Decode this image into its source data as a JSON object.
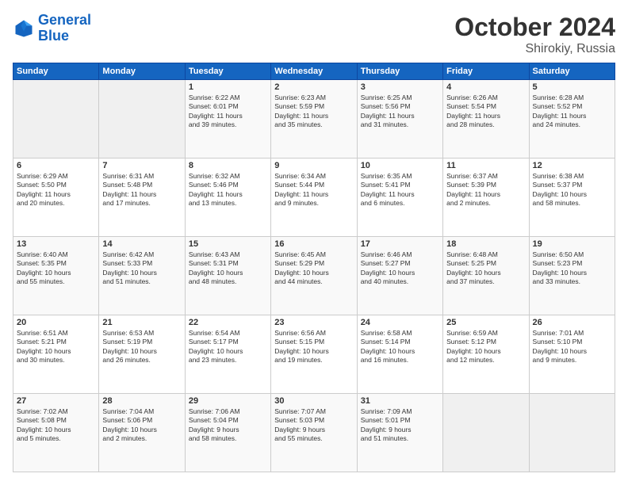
{
  "logo": {
    "line1": "General",
    "line2": "Blue"
  },
  "title": "October 2024",
  "subtitle": "Shirokiy, Russia",
  "days_of_week": [
    "Sunday",
    "Monday",
    "Tuesday",
    "Wednesday",
    "Thursday",
    "Friday",
    "Saturday"
  ],
  "weeks": [
    [
      {
        "day": "",
        "content": ""
      },
      {
        "day": "",
        "content": ""
      },
      {
        "day": "1",
        "content": "Sunrise: 6:22 AM\nSunset: 6:01 PM\nDaylight: 11 hours\nand 39 minutes."
      },
      {
        "day": "2",
        "content": "Sunrise: 6:23 AM\nSunset: 5:59 PM\nDaylight: 11 hours\nand 35 minutes."
      },
      {
        "day": "3",
        "content": "Sunrise: 6:25 AM\nSunset: 5:56 PM\nDaylight: 11 hours\nand 31 minutes."
      },
      {
        "day": "4",
        "content": "Sunrise: 6:26 AM\nSunset: 5:54 PM\nDaylight: 11 hours\nand 28 minutes."
      },
      {
        "day": "5",
        "content": "Sunrise: 6:28 AM\nSunset: 5:52 PM\nDaylight: 11 hours\nand 24 minutes."
      }
    ],
    [
      {
        "day": "6",
        "content": "Sunrise: 6:29 AM\nSunset: 5:50 PM\nDaylight: 11 hours\nand 20 minutes."
      },
      {
        "day": "7",
        "content": "Sunrise: 6:31 AM\nSunset: 5:48 PM\nDaylight: 11 hours\nand 17 minutes."
      },
      {
        "day": "8",
        "content": "Sunrise: 6:32 AM\nSunset: 5:46 PM\nDaylight: 11 hours\nand 13 minutes."
      },
      {
        "day": "9",
        "content": "Sunrise: 6:34 AM\nSunset: 5:44 PM\nDaylight: 11 hours\nand 9 minutes."
      },
      {
        "day": "10",
        "content": "Sunrise: 6:35 AM\nSunset: 5:41 PM\nDaylight: 11 hours\nand 6 minutes."
      },
      {
        "day": "11",
        "content": "Sunrise: 6:37 AM\nSunset: 5:39 PM\nDaylight: 11 hours\nand 2 minutes."
      },
      {
        "day": "12",
        "content": "Sunrise: 6:38 AM\nSunset: 5:37 PM\nDaylight: 10 hours\nand 58 minutes."
      }
    ],
    [
      {
        "day": "13",
        "content": "Sunrise: 6:40 AM\nSunset: 5:35 PM\nDaylight: 10 hours\nand 55 minutes."
      },
      {
        "day": "14",
        "content": "Sunrise: 6:42 AM\nSunset: 5:33 PM\nDaylight: 10 hours\nand 51 minutes."
      },
      {
        "day": "15",
        "content": "Sunrise: 6:43 AM\nSunset: 5:31 PM\nDaylight: 10 hours\nand 48 minutes."
      },
      {
        "day": "16",
        "content": "Sunrise: 6:45 AM\nSunset: 5:29 PM\nDaylight: 10 hours\nand 44 minutes."
      },
      {
        "day": "17",
        "content": "Sunrise: 6:46 AM\nSunset: 5:27 PM\nDaylight: 10 hours\nand 40 minutes."
      },
      {
        "day": "18",
        "content": "Sunrise: 6:48 AM\nSunset: 5:25 PM\nDaylight: 10 hours\nand 37 minutes."
      },
      {
        "day": "19",
        "content": "Sunrise: 6:50 AM\nSunset: 5:23 PM\nDaylight: 10 hours\nand 33 minutes."
      }
    ],
    [
      {
        "day": "20",
        "content": "Sunrise: 6:51 AM\nSunset: 5:21 PM\nDaylight: 10 hours\nand 30 minutes."
      },
      {
        "day": "21",
        "content": "Sunrise: 6:53 AM\nSunset: 5:19 PM\nDaylight: 10 hours\nand 26 minutes."
      },
      {
        "day": "22",
        "content": "Sunrise: 6:54 AM\nSunset: 5:17 PM\nDaylight: 10 hours\nand 23 minutes."
      },
      {
        "day": "23",
        "content": "Sunrise: 6:56 AM\nSunset: 5:15 PM\nDaylight: 10 hours\nand 19 minutes."
      },
      {
        "day": "24",
        "content": "Sunrise: 6:58 AM\nSunset: 5:14 PM\nDaylight: 10 hours\nand 16 minutes."
      },
      {
        "day": "25",
        "content": "Sunrise: 6:59 AM\nSunset: 5:12 PM\nDaylight: 10 hours\nand 12 minutes."
      },
      {
        "day": "26",
        "content": "Sunrise: 7:01 AM\nSunset: 5:10 PM\nDaylight: 10 hours\nand 9 minutes."
      }
    ],
    [
      {
        "day": "27",
        "content": "Sunrise: 7:02 AM\nSunset: 5:08 PM\nDaylight: 10 hours\nand 5 minutes."
      },
      {
        "day": "28",
        "content": "Sunrise: 7:04 AM\nSunset: 5:06 PM\nDaylight: 10 hours\nand 2 minutes."
      },
      {
        "day": "29",
        "content": "Sunrise: 7:06 AM\nSunset: 5:04 PM\nDaylight: 9 hours\nand 58 minutes."
      },
      {
        "day": "30",
        "content": "Sunrise: 7:07 AM\nSunset: 5:03 PM\nDaylight: 9 hours\nand 55 minutes."
      },
      {
        "day": "31",
        "content": "Sunrise: 7:09 AM\nSunset: 5:01 PM\nDaylight: 9 hours\nand 51 minutes."
      },
      {
        "day": "",
        "content": ""
      },
      {
        "day": "",
        "content": ""
      }
    ]
  ]
}
